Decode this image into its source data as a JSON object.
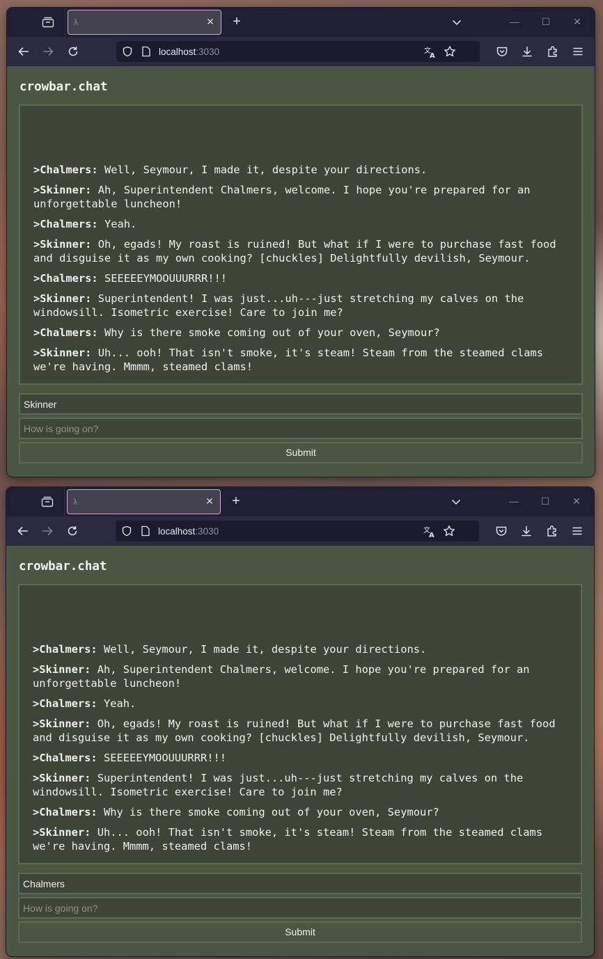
{
  "windows": [
    {
      "tab_title": "λ",
      "url_host": "localhost",
      "url_port": ":3030",
      "app_title": "crowbar.chat",
      "name_value": "Skinner",
      "message_placeholder": "How is going on?",
      "submit_label": "Submit"
    },
    {
      "tab_title": "λ",
      "url_host": "localhost",
      "url_port": ":3030",
      "app_title": "crowbar.chat",
      "name_value": "Chalmers",
      "message_placeholder": "How is going on?",
      "submit_label": "Submit"
    }
  ],
  "messages": [
    {
      "caret": ">",
      "speaker": "Chalmers:",
      "text": "Well, Seymour, I made it, despite your directions."
    },
    {
      "caret": ">",
      "speaker": "Skinner:",
      "text": "Ah, Superintendent Chalmers, welcome. I hope you're prepared for an unforgettable luncheon!"
    },
    {
      "caret": ">",
      "speaker": "Chalmers:",
      "text": "Yeah."
    },
    {
      "caret": ">",
      "speaker": "Skinner:",
      "text": "Oh, egads! My roast is ruined! But what if I were to purchase fast food and disguise it as my own cooking? [chuckles] Delightfully devilish, Seymour."
    },
    {
      "caret": ">",
      "speaker": "Chalmers:",
      "text": "SEEEEEYMOOUUURRR!!!"
    },
    {
      "caret": ">",
      "speaker": "Skinner:",
      "text": "Superintendent! I was just...uh---just stretching my calves on the windowsill. Isometric exercise! Care to join me?"
    },
    {
      "caret": ">",
      "speaker": "Chalmers:",
      "text": "Why is there smoke coming out of your oven, Seymour?"
    },
    {
      "caret": ">",
      "speaker": "Skinner:",
      "text": "Uh... ooh! That isn't smoke, it's steam! Steam from the steamed clams we're having. Mmmm, steamed clams!"
    }
  ]
}
